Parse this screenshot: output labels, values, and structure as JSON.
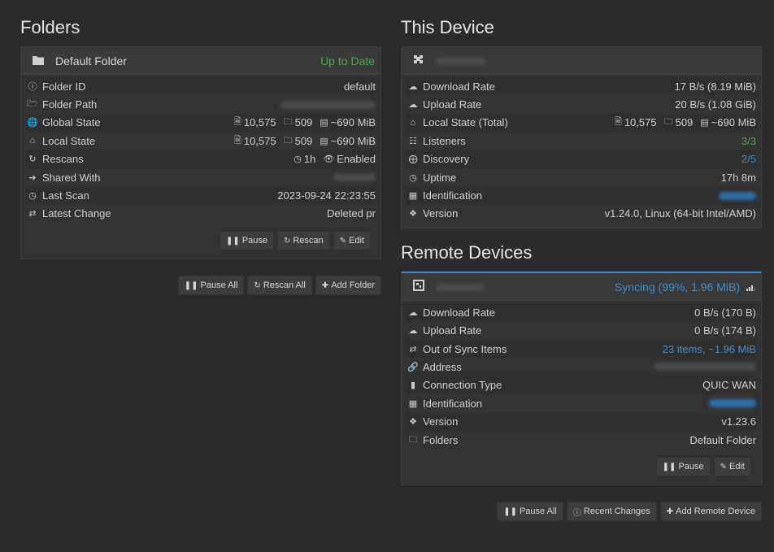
{
  "folders": {
    "heading": "Folders",
    "folder": {
      "name": "Default Folder",
      "status": "Up to Date",
      "rows": {
        "folder_id": {
          "label": "Folder ID",
          "value": "default"
        },
        "folder_path": {
          "label": "Folder Path"
        },
        "global_state": {
          "label": "Global State",
          "files": "10,575",
          "dirs": "509",
          "size": "~690 MiB"
        },
        "local_state": {
          "label": "Local State",
          "files": "10,575",
          "dirs": "509",
          "size": "~690 MiB"
        },
        "rescans": {
          "label": "Rescans",
          "interval": "1h",
          "watch": "Enabled"
        },
        "shared_with": {
          "label": "Shared With"
        },
        "last_scan": {
          "label": "Last Scan",
          "value": "2023-09-24 22:23:55"
        },
        "latest_change": {
          "label": "Latest Change",
          "value": "Deleted pr"
        }
      },
      "buttons": {
        "pause": "Pause",
        "rescan": "Rescan",
        "edit": "Edit"
      }
    },
    "buttons": {
      "pause_all": "Pause All",
      "rescan_all": "Rescan All",
      "add_folder": "Add Folder"
    }
  },
  "this_device": {
    "heading": "This Device",
    "rows": {
      "download_rate": {
        "label": "Download Rate",
        "value": "17 B/s (8.19 MiB)"
      },
      "upload_rate": {
        "label": "Upload Rate",
        "value": "20 B/s (1.08 GiB)"
      },
      "local_state_total": {
        "label": "Local State (Total)",
        "files": "10,575",
        "dirs": "509",
        "size": "~690 MiB"
      },
      "listeners": {
        "label": "Listeners",
        "value": "3/3"
      },
      "discovery": {
        "label": "Discovery",
        "value": "2/5"
      },
      "uptime": {
        "label": "Uptime",
        "value": "17h 8m"
      },
      "identification": {
        "label": "Identification"
      },
      "version": {
        "label": "Version",
        "value": "v1.24.0, Linux (64-bit Intel/AMD)"
      }
    }
  },
  "remote_devices": {
    "heading": "Remote Devices",
    "device": {
      "status": "Syncing (99%, 1.96 MiB)",
      "rows": {
        "download_rate": {
          "label": "Download Rate",
          "value": "0 B/s (170 B)"
        },
        "upload_rate": {
          "label": "Upload Rate",
          "value": "0 B/s (174 B)"
        },
        "out_of_sync": {
          "label": "Out of Sync Items",
          "value": "23 items, ~1.96 MiB"
        },
        "address": {
          "label": "Address"
        },
        "connection_type": {
          "label": "Connection Type",
          "value": "QUIC WAN"
        },
        "identification": {
          "label": "Identification"
        },
        "version": {
          "label": "Version",
          "value": "v1.23.6"
        },
        "folders": {
          "label": "Folders",
          "value": "Default Folder"
        }
      },
      "buttons": {
        "pause": "Pause",
        "edit": "Edit"
      }
    },
    "buttons": {
      "pause_all": "Pause All",
      "recent_changes": "Recent Changes",
      "add_remote_device": "Add Remote Device"
    }
  },
  "colors": {
    "up_to_date": "#44ad41",
    "syncing": "#3c8dd1",
    "background": "#2b2b2b",
    "panel": "#333333"
  },
  "icons": [
    "folder-icon",
    "info-icon",
    "folder-open-icon",
    "globe-icon",
    "home-icon",
    "refresh-icon",
    "share-icon",
    "clock-icon",
    "exchange-icon",
    "file-icon",
    "hdd-icon",
    "eye-icon",
    "pause-icon",
    "pencil-icon",
    "plus-icon",
    "puzzle-icon",
    "cloud-download-icon",
    "cloud-upload-icon",
    "sitemap-icon",
    "signpost-icon",
    "qrcode-icon",
    "tag-icon",
    "link-icon",
    "signal-icon"
  ]
}
